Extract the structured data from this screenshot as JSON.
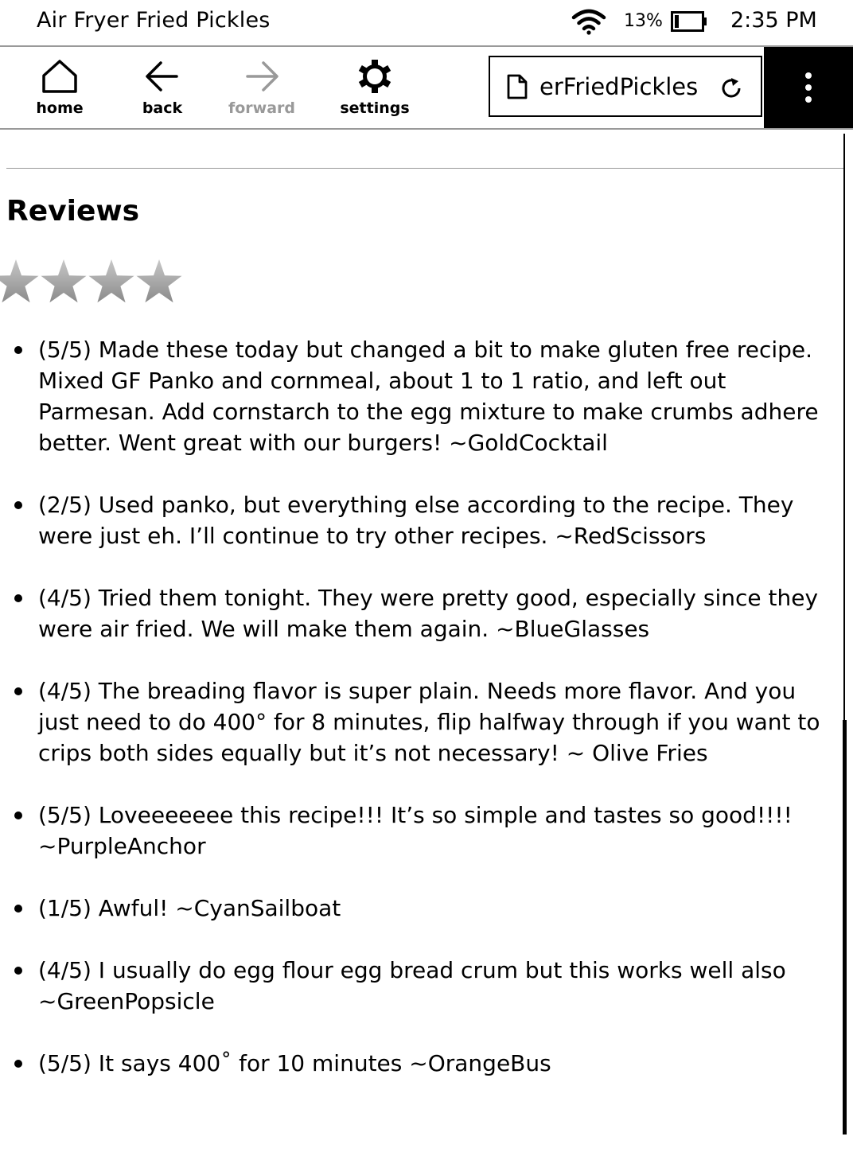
{
  "status": {
    "title": "Air Fryer Fried Pickles",
    "battery": "13%",
    "time": "2:35 PM",
    "icons": [
      "wifi-icon",
      "battery-icon"
    ]
  },
  "toolbar": {
    "home": "home",
    "back": "back",
    "forward": "forward",
    "settings": "settings",
    "url": "erFriedPickles",
    "icons": [
      "home-icon",
      "back-arrow-icon",
      "forward-arrow-icon",
      "gear-icon",
      "document-icon",
      "reload-icon",
      "more-vertical-icon"
    ]
  },
  "content": {
    "heading": "Reviews",
    "stars_shown": 4,
    "reviews": [
      "(5/5) Made these today but changed a bit to make gluten free recipe. Mixed GF Panko and cornmeal, about 1 to 1 ratio, and left out Parmesan. Add cornstarch to the egg mixture to make crumbs adhere better. Went great with our burgers! ~GoldCocktail",
      "(2/5) Used panko, but everything else according to the recipe. They were just eh. I’ll continue to try other recipes. ~RedScissors",
      "(4/5) Tried them tonight. They were pretty good, especially since they were air fried. We will make them again. ~BlueGlasses",
      "(4/5) The breading flavor is super plain. Needs more flavor. And you just need to do 400° for 8 minutes, flip halfway through if you want to crips both sides equally but it’s not necessary! ~ Olive Fries",
      "(5/5) Loveeeeeee this recipe!!! It’s so simple and tastes so good!!!! ~PurpleAnchor",
      "(1/5) Awful! ~CyanSailboat",
      "(4/5) I usually do egg flour egg bread crum but this works well also ~GreenPopsicle",
      "(5/5) It says 400˚ for 10 minutes ~OrangeBus"
    ]
  }
}
